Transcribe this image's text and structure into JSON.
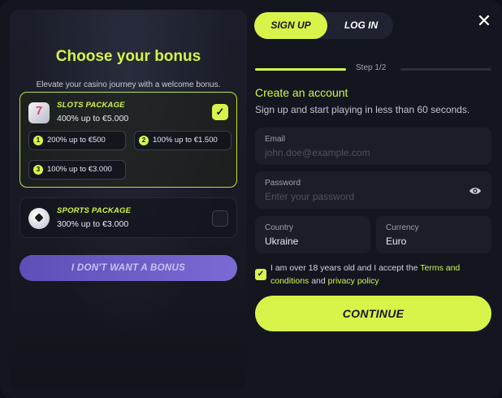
{
  "tabs": {
    "signup": "SIGN UP",
    "login": "LOG IN"
  },
  "close_icon": "close-icon",
  "bonus": {
    "title": "Choose your bonus",
    "subtitle": "Elevate your casino journey with a welcome bonus.",
    "slots": {
      "title": "SLOTS PACKAGE",
      "desc": "400% up to €5.000",
      "selected": true,
      "offers": [
        {
          "num": "1",
          "text": "200% up to €500"
        },
        {
          "num": "2",
          "text": "100% up to €1.500"
        },
        {
          "num": "3",
          "text": "100% up to €3.000"
        }
      ]
    },
    "sports": {
      "title": "SPORTS PACKAGE",
      "desc": "300% up to €3.000",
      "selected": false
    },
    "no_bonus": "I DON'T WANT A BONUS"
  },
  "form": {
    "step": "Step 1/2",
    "title": "Create an account",
    "subtitle": "Sign up and start playing in less than 60 seconds.",
    "email": {
      "label": "Email",
      "placeholder": "john.doe@example.com",
      "value": ""
    },
    "password": {
      "label": "Password",
      "placeholder": "Enter your password",
      "value": ""
    },
    "country": {
      "label": "Country",
      "value": "Ukraine"
    },
    "currency": {
      "label": "Currency",
      "value": "Euro"
    },
    "agree": {
      "text": "I am over 18 years old and I accept the ",
      "terms": "Terms and conditions",
      "and": " and ",
      "privacy": "privacy policy",
      "checked": true
    },
    "continue": "CONTINUE"
  },
  "colors": {
    "accent": "#d8f34a",
    "bonus_button": "#6a5bc6",
    "background": "#13151f"
  }
}
